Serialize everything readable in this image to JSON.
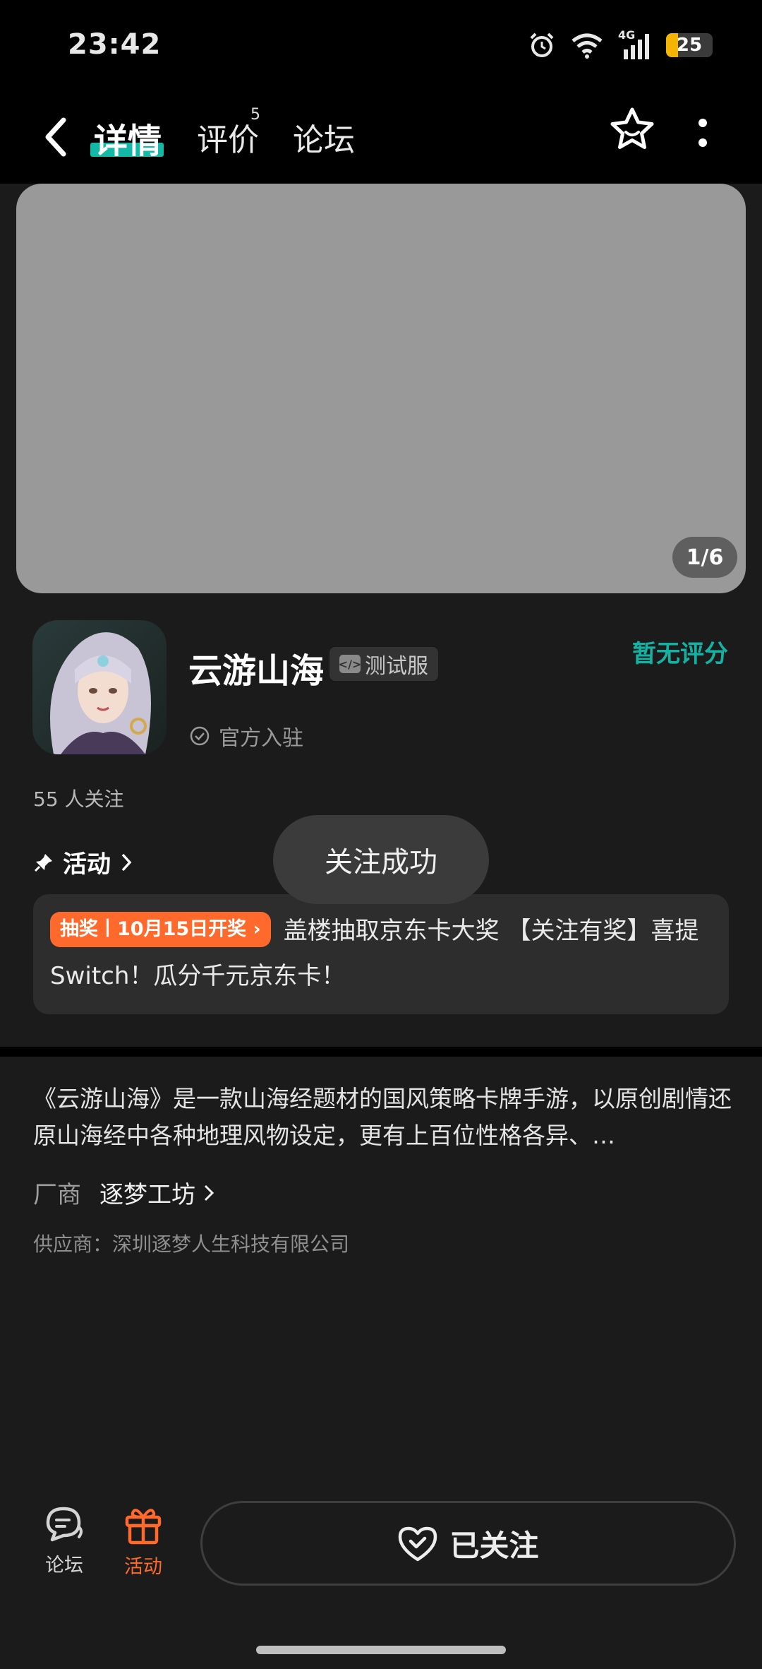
{
  "status_bar": {
    "time": "23:42",
    "network": "4G",
    "battery": "25"
  },
  "nav": {
    "tabs": [
      {
        "label": "详情"
      },
      {
        "label": "评价",
        "badge": "5"
      },
      {
        "label": "论坛"
      }
    ]
  },
  "banner": {
    "counter": "1/6"
  },
  "app": {
    "name": "云游山海",
    "tag": "测试服",
    "rating": "暂无评分",
    "official": "官方入驻",
    "followers": "55 人关注"
  },
  "activity": {
    "title": "活动",
    "tag": "抽奖丨10月15日开奖",
    "text": "盖楼抽取京东卡大奖 【关注有奖】喜提Switch！瓜分千元京东卡！"
  },
  "toast": "关注成功",
  "description": "《云游山海》是一款山海经题材的国风策略卡牌手游，以原创剧情还原山海经中各种地理风物设定，更有上百位性格各异、…",
  "vendor": {
    "label": "厂商",
    "name": "逐梦工坊"
  },
  "supplier": "供应商：深圳逐梦人生科技有限公司",
  "bottom": {
    "forum_label": "论坛",
    "activity_label": "活动",
    "follow_label": "已关注"
  },
  "colors": {
    "accent": "#13b3a3",
    "orange": "#ff6a2c",
    "background": "#1b1b1b"
  }
}
